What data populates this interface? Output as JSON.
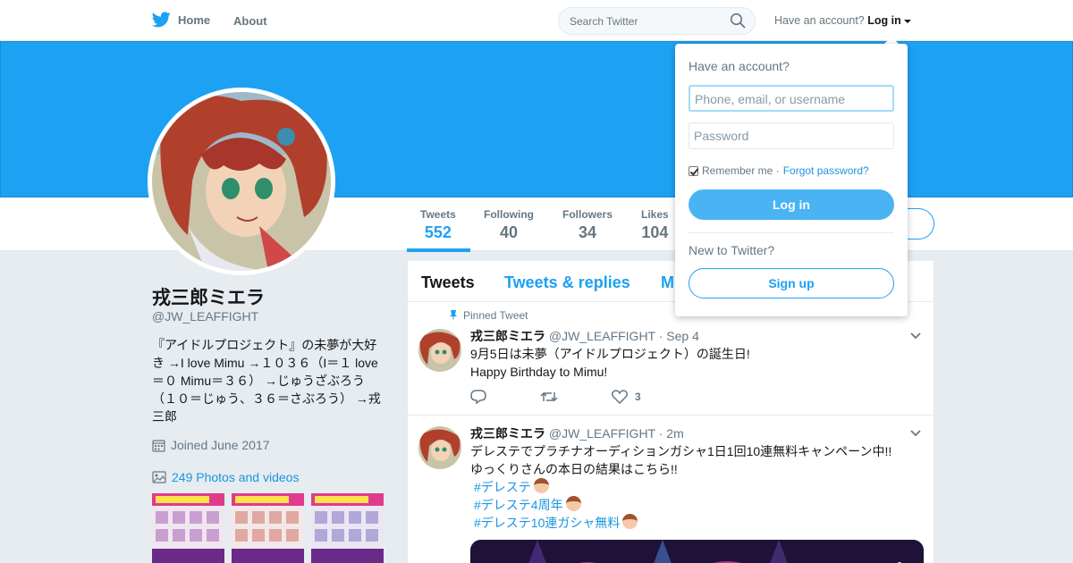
{
  "nav": {
    "home_label": "Home",
    "about_label": "About",
    "search_placeholder": "Search Twitter",
    "have_account_text": "Have an account?",
    "login_label": "Log in"
  },
  "profile": {
    "name": "戎三郎ミエラ",
    "handle": "@JW_LEAFFIGHT",
    "bio": "『アイドルプロジェクト』の未夢が大好き →I love Mimu →１０３６（I＝１ love＝０ Mimu＝３６） →じゅうざぶろう（１０＝じゅう、３６＝さぶろう） →戎三郎",
    "joined": "Joined June 2017",
    "photos_link": "249 Photos and videos"
  },
  "stats": [
    {
      "label": "Tweets",
      "value": "552"
    },
    {
      "label": "Following",
      "value": "40"
    },
    {
      "label": "Followers",
      "value": "34"
    },
    {
      "label": "Likes",
      "value": "104"
    }
  ],
  "timeline": {
    "tabs": [
      "Tweets",
      "Tweets & replies",
      "M"
    ],
    "tweets": [
      {
        "pinned_label": "Pinned Tweet",
        "name": "戎三郎ミエラ",
        "handle": "@JW_LEAFFIGHT",
        "time": "· Sep 4",
        "lines": [
          "9月5日は未夢（アイドルプロジェクト）の誕生日!",
          "Happy Birthday to Mimu!"
        ],
        "like_count": "3"
      },
      {
        "name": "戎三郎ミエラ",
        "handle": "@JW_LEAFFIGHT",
        "time": "· 2m",
        "lines": [
          "デレステでプラチナオーディションガシャ1日1回10連無料キャンペーン中!!",
          "ゆっくりさんの本日の結果はこちら!!"
        ],
        "hashtags": [
          "#デレステ",
          "#デレステ4周年",
          "#デレステ10連ガシャ無料"
        ]
      }
    ]
  },
  "login_dropdown": {
    "title": "Have an account?",
    "username_placeholder": "Phone, email, or username",
    "password_placeholder": "Password",
    "remember_label": "Remember me ·",
    "forgot_label": "Forgot password?",
    "login_button": "Log in",
    "new_label": "New to Twitter?",
    "signup_button": "Sign up"
  },
  "colors": {
    "accent": "#1da1f2",
    "banner": "#1da1f2",
    "link": "#1b95e0"
  }
}
